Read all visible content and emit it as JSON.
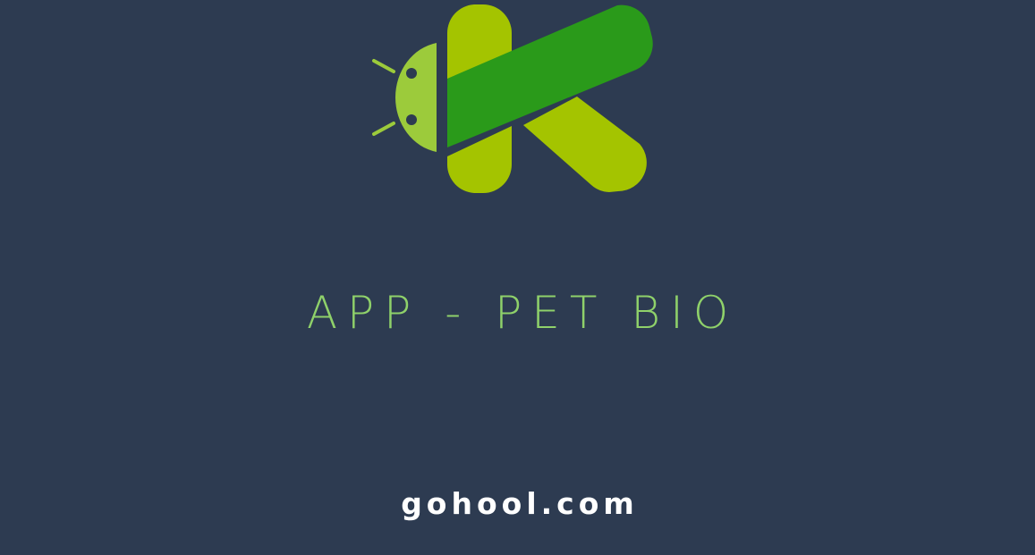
{
  "splash": {
    "title": "APP - PET BIO",
    "website": "gohool.com"
  },
  "logo": {
    "icon": "android-k-logo-icon"
  },
  "colors": {
    "background": "#2d3b51",
    "title": "#8fd16a",
    "website": "#ffffff",
    "logo_light_green": "#a4c400",
    "logo_dark_green": "#2a9a1a",
    "logo_android_green": "#9ccb3b"
  }
}
